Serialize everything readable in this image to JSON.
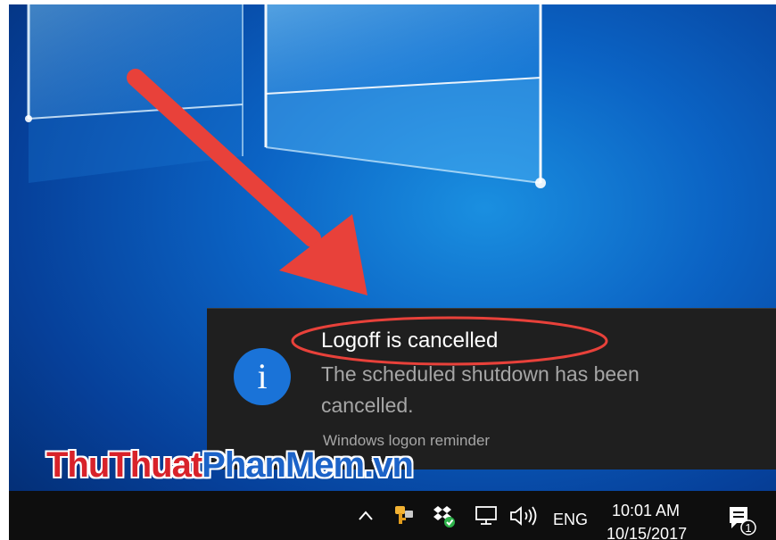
{
  "toast": {
    "icon": "info-icon",
    "icon_glyph": "i",
    "title": "Logoff is cancelled",
    "body": "The scheduled shutdown has been cancelled.",
    "source": "Windows logon reminder"
  },
  "watermark": {
    "part1": "ThuThuat",
    "part2": "PhanMem.vn"
  },
  "taskbar": {
    "tray_icons": [
      "chevron-up-icon",
      "key-icon",
      "dropbox-icon",
      "network-icon",
      "volume-icon"
    ],
    "language": "ENG",
    "time": "10:01 AM",
    "date": "10/15/2017",
    "notification_count": "1"
  },
  "colors": {
    "desktop_blue": "#0b63c4",
    "toast_bg": "#1f1f1f",
    "info_blue": "#1a73d8",
    "annotation_red": "#e8413a",
    "taskbar_bg": "#0e0e0e"
  }
}
